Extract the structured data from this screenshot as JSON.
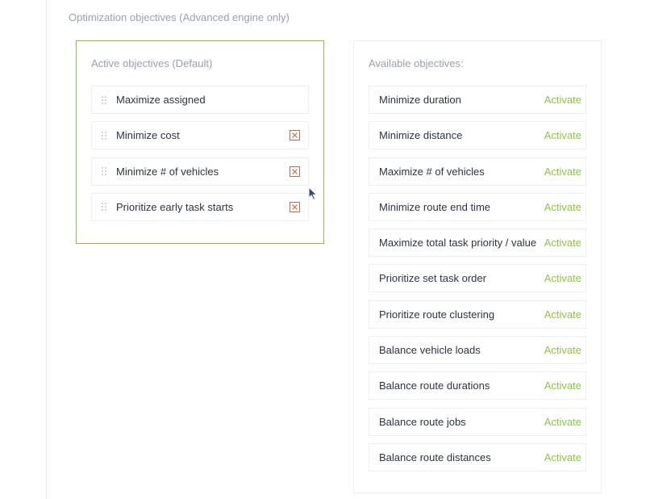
{
  "section": {
    "title": "Optimization objectives (Advanced engine only)"
  },
  "active_panel": {
    "title": "Active objectives (Default)",
    "items": [
      {
        "label": "Maximize assigned",
        "removable": false
      },
      {
        "label": "Minimize cost",
        "removable": true
      },
      {
        "label": "Minimize # of vehicles",
        "removable": true
      },
      {
        "label": "Prioritize early task starts",
        "removable": true
      }
    ]
  },
  "available_panel": {
    "title": "Available objectives:",
    "activate_label": "Activate",
    "items": [
      {
        "label": "Minimize duration"
      },
      {
        "label": "Minimize distance"
      },
      {
        "label": "Maximize # of vehicles"
      },
      {
        "label": "Minimize route end time"
      },
      {
        "label": "Maximize total task priority / value"
      },
      {
        "label": "Prioritize set task order"
      },
      {
        "label": "Prioritize route clustering"
      },
      {
        "label": "Balance vehicle loads"
      },
      {
        "label": "Balance route durations"
      },
      {
        "label": "Balance route jobs"
      },
      {
        "label": "Balance route distances"
      }
    ]
  },
  "colors": {
    "accent_green": "#8cc63f",
    "remove_icon": "#c0694a",
    "muted_text": "#98a1ad",
    "body_text": "#2c3440"
  },
  "icons": {
    "drag_handle": "drag-handle-icon",
    "remove": "remove-x-icon",
    "cursor": "mouse-cursor-icon"
  }
}
